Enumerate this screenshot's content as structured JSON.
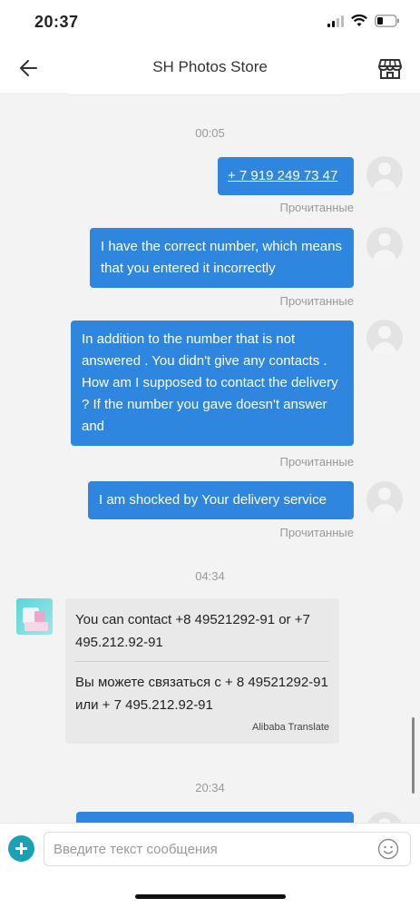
{
  "status": {
    "time": "20:37"
  },
  "header": {
    "title": "SH Photos Store",
    "back_icon": "back-arrow-icon",
    "store_icon": "store-icon"
  },
  "chat": {
    "timestamps": [
      "00:05",
      "04:34",
      "20:34"
    ],
    "outgoing": [
      {
        "text": "+ 7 919 249 73 47",
        "status": "Прочитанные",
        "is_link": true
      },
      {
        "text": "I have the correct number, which means that you entered it incorrectly",
        "status": "Прочитанные"
      },
      {
        "text": "In addition to the number that is not answered . You didn't give any contacts . How am I supposed to contact the delivery ? If the number you gave doesn't answer and",
        "status": "Прочитанные"
      },
      {
        "text": "I am shocked by Your delivery service",
        "status": "Прочитанные"
      }
    ],
    "incoming": {
      "original": "You can contact +8 49521292-91 or +7 495.212.92-91",
      "translated": "Вы можете связаться с + 8 49521292-91 или + 7 495.212.92-91",
      "translate_label": "Alibaba Translate"
    }
  },
  "input": {
    "placeholder": "Введите текст сообщения",
    "add_icon": "plus-icon",
    "emoji_icon": "emoji-icon"
  },
  "colors": {
    "outgoing_bubble": "#2f86de",
    "incoming_bubble": "#e9e9e9",
    "add_button": "#1aa1b3",
    "background": "#f3f3f3"
  }
}
